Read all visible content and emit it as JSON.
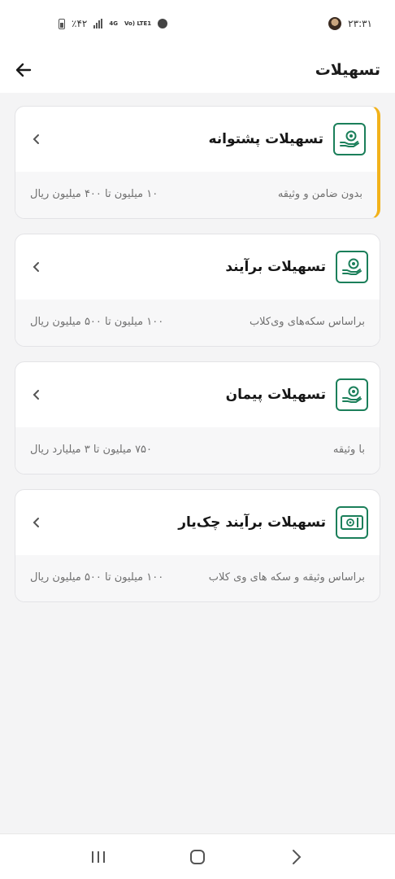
{
  "status_bar": {
    "time": "۲۳:۳۱",
    "battery": "٪۴۲",
    "network": "4G",
    "volte": "Vo) LTE1"
  },
  "app_bar": {
    "title": "تسهیلات",
    "back_icon": "arrow-left-icon"
  },
  "cards": [
    {
      "title": "تسهیلات پشتوانه",
      "condition": "بدون ضامن و وثیقه",
      "range": "۱۰ میلیون تا ۴۰۰ میلیون ریال",
      "icon": "hand-coin-icon",
      "active": true
    },
    {
      "title": "تسهیلات برآیند",
      "condition": "براساس سکه‌های وی‌کلاب",
      "range": "۱۰۰ میلیون تا ۵۰۰ میلیون ریال",
      "icon": "hand-coin-icon",
      "active": false
    },
    {
      "title": "تسهیلات پیمان",
      "condition": "با وثیقه",
      "range": "۷۵۰ میلیون تا ۳ میلیارد ریال",
      "icon": "hand-coin-icon",
      "active": false
    },
    {
      "title": "تسهیلات برآیند چک‌یار",
      "condition": "براساس وثیقه و سکه های وی کلاب",
      "range": "۱۰۰ میلیون تا ۵۰۰ میلیون ریال",
      "icon": "cheque-icon",
      "active": false
    }
  ],
  "colors": {
    "accent": "#f2b21b",
    "icon_green": "#1b7f5a"
  }
}
